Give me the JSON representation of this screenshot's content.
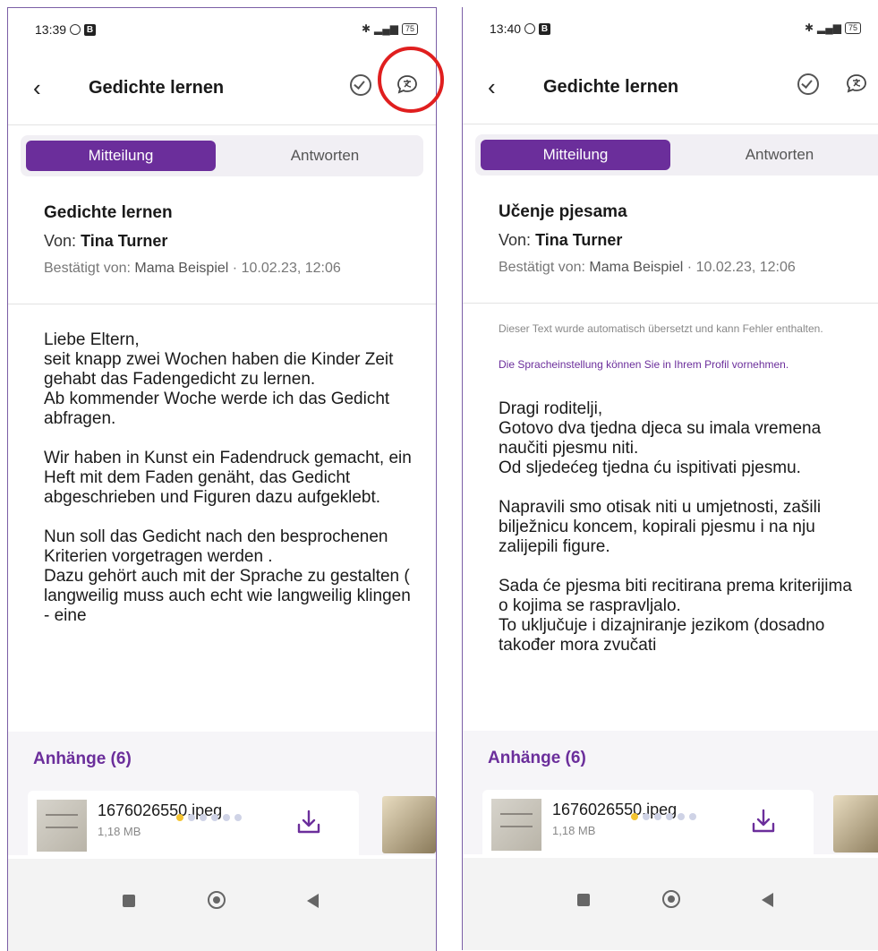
{
  "left": {
    "status_time": "13:39",
    "app_title": "Gedichte lernen",
    "tabs": [
      "Mitteilung",
      "Antworten"
    ],
    "message_title": "Gedichte lernen",
    "from_label": "Von:",
    "from_name": "Tina Turner",
    "confirmed_label": "Bestätigt von:",
    "confirmed_by": "Mama Beispiel",
    "confirmed_date": "· 10.02.23, 12:06",
    "body": "Liebe Eltern,\nseit knapp zwei Wochen haben die Kinder Zeit gehabt das Fadengedicht zu lernen.\nAb kommender Woche werde ich das Gedicht abfragen.\n\nWir haben in Kunst ein Fadendruck gemacht, ein Heft mit dem Faden genäht, das Gedicht abgeschrieben und Figuren dazu aufgeklebt.\n\nNun soll das Gedicht nach den besprochenen Kriterien vorgetragen werden .\nDazu gehört auch mit der Sprache zu gestalten ( langweilig muss auch echt wie langweilig klingen - eine",
    "attachments_title": "Anhänge (6)",
    "file_name": "1676026550.jpeg",
    "file_size": "1,18 MB"
  },
  "right": {
    "status_time": "13:40",
    "app_title": "Gedichte lernen",
    "tabs": [
      "Mitteilung",
      "Antworten"
    ],
    "message_title": "Učenje pjesama",
    "from_label": "Von:",
    "from_name": "Tina Turner",
    "confirmed_label": "Bestätigt von:",
    "confirmed_by": "Mama Beispiel",
    "confirmed_date": "· 10.02.23, 12:06",
    "translation_note": "Dieser Text wurde automatisch übersetzt und kann Fehler enthalten.",
    "language_note": "Die Spracheinstellung können Sie in Ihrem Profil vornehmen.",
    "body": "Dragi roditelji,\nGotovo dva tjedna djeca su imala vremena naučiti pjesmu niti.\nOd sljedećeg tjedna ću ispitivati pjesmu.\n\nNapravili smo otisak niti u umjetnosti, zašili bilježnicu koncem, kopirali pjesmu i na nju zalijepili figure.\n\nSada će pjesma biti recitirana prema kriterijima o kojima se raspravljalo.\nTo uključuje i dizajniranje jezikom (dosadno također mora zvučati",
    "attachments_title": "Anhänge (6)",
    "file_name": "1676026550.jpeg",
    "file_size": "1,18 MB"
  },
  "pagination": {
    "total": 6,
    "active_index": 0
  },
  "colors": {
    "accent": "#6b2e9b",
    "highlight": "#e01f1f",
    "dot_active": "#f4c430"
  },
  "icons": [
    "back-icon",
    "check-circle-icon",
    "translate-chat-icon",
    "download-icon",
    "nav-recents-icon",
    "nav-home-icon",
    "nav-back-icon"
  ]
}
